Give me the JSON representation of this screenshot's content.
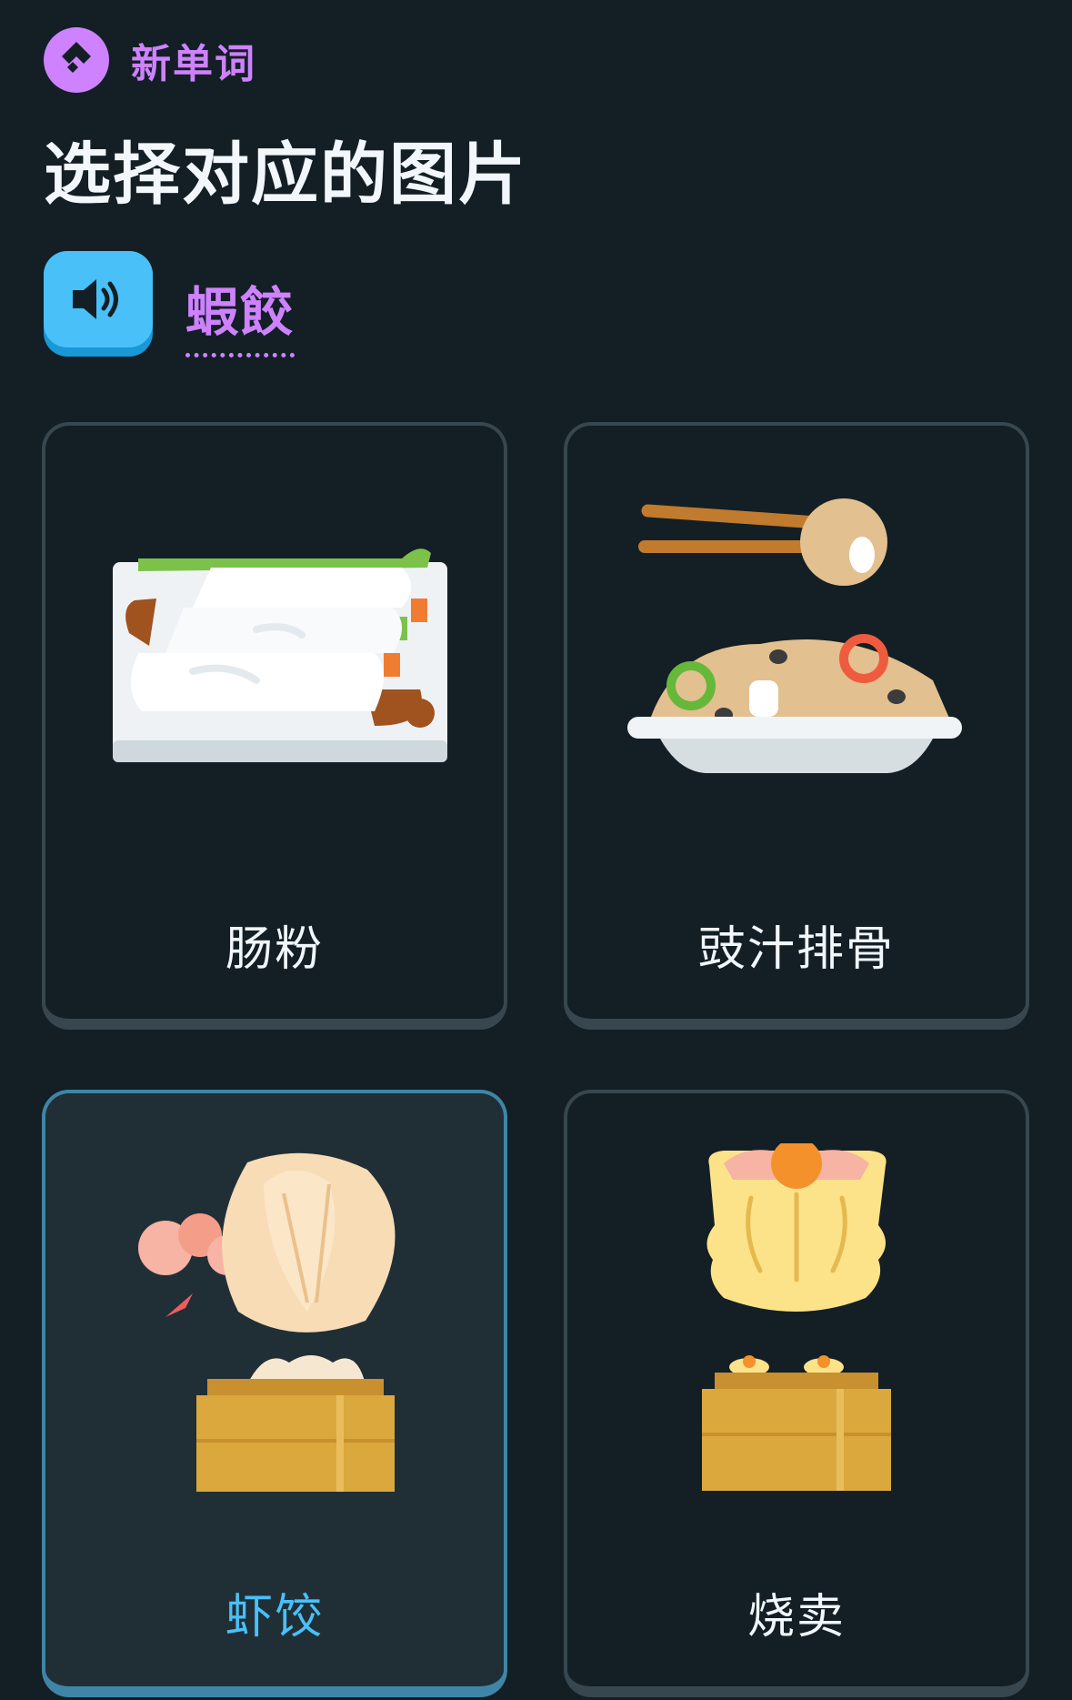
{
  "header": {
    "badge_icon": "new-word-icon",
    "badge_label": "新单词",
    "title": "选择对应的图片"
  },
  "prompt": {
    "speaker_icon": "speaker-icon",
    "word": "蝦餃"
  },
  "options": [
    {
      "label": "肠粉",
      "icon": "rice-noodle-roll-icon",
      "selected": false
    },
    {
      "label": "豉汁排骨",
      "icon": "black-bean-spare-ribs-icon",
      "selected": false
    },
    {
      "label": "虾饺",
      "icon": "shrimp-dumpling-icon",
      "selected": true
    },
    {
      "label": "烧卖",
      "icon": "siu-mai-icon",
      "selected": false
    }
  ],
  "colors": {
    "background": "#131f24",
    "accent_purple": "#ce82ff",
    "accent_blue": "#49c0f8",
    "card_border": "#37464f",
    "selected_border": "#3f85a7"
  }
}
